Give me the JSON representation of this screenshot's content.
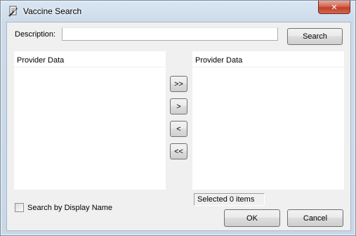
{
  "window": {
    "title": "Vaccine Search",
    "close_symbol": "✕"
  },
  "search": {
    "description_label": "Description:",
    "description_value": "",
    "search_button": "Search"
  },
  "left_panel": {
    "header": "Provider Data",
    "items": []
  },
  "right_panel": {
    "header": "Provider Data",
    "items": []
  },
  "transfer": {
    "add_all": ">>",
    "add_one": ">",
    "remove_one": "<",
    "remove_all": "<<"
  },
  "status": {
    "selected_text": "Selected 0 items"
  },
  "options": {
    "search_by_display_name_label": "Search by Display Name",
    "search_by_display_name_checked": false
  },
  "footer": {
    "ok_label": "OK",
    "cancel_label": "Cancel"
  },
  "icons": {
    "app": "syringe-document-icon",
    "close": "close-icon"
  },
  "colors": {
    "close_button": "#c8472f",
    "panel_background": "#ffffff",
    "dialog_background": "#f0f0f0"
  }
}
